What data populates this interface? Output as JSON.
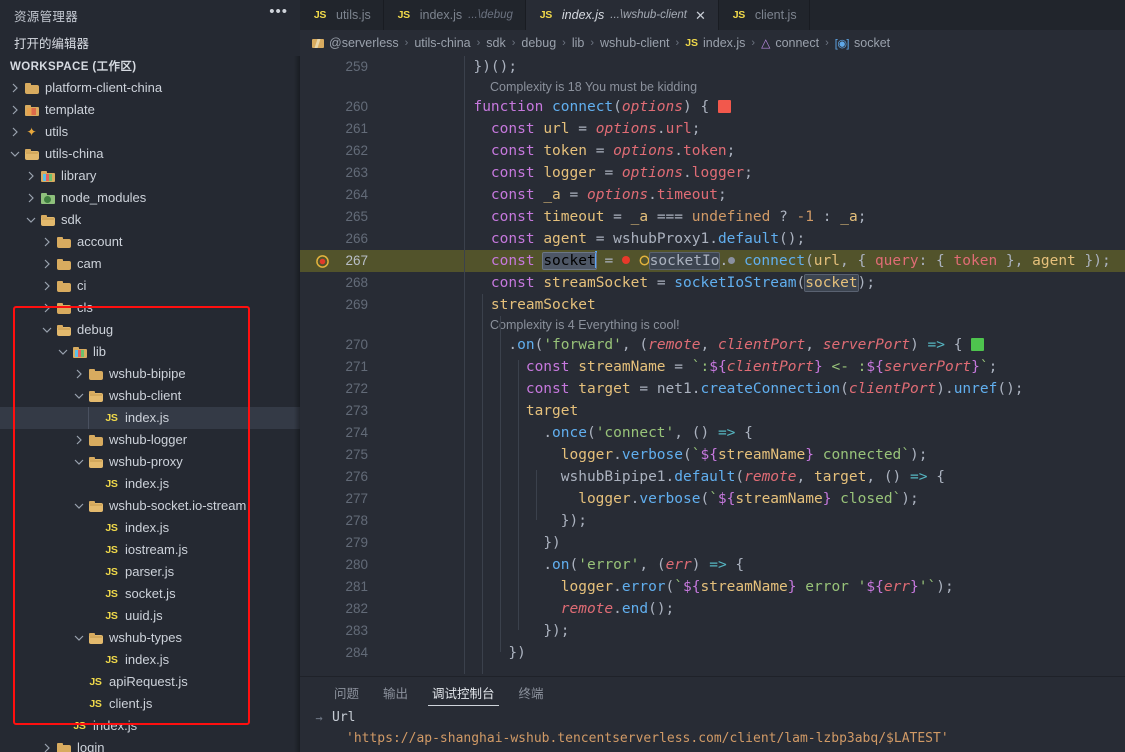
{
  "sidebar": {
    "title": "资源管理器",
    "menu_icon": "ellipsis-icon",
    "open_editors_label": "打开的编辑器",
    "workspace_label": "WORKSPACE (工作区)",
    "tree": [
      {
        "label": "platform-client-china",
        "type": "folder",
        "icon": "folder-icon",
        "depth": 1,
        "state": "collapsed"
      },
      {
        "label": "template",
        "type": "folder",
        "icon": "template-folder-icon",
        "depth": 1,
        "state": "collapsed"
      },
      {
        "label": "utils",
        "type": "folder",
        "icon": "utils-folder-icon",
        "depth": 1,
        "state": "collapsed"
      },
      {
        "label": "utils-china",
        "type": "folder",
        "icon": "folder-open-icon",
        "depth": 1,
        "state": "expanded"
      },
      {
        "label": "library",
        "type": "folder",
        "icon": "library-folder-icon",
        "depth": 2,
        "state": "collapsed"
      },
      {
        "label": "node_modules",
        "type": "folder",
        "icon": "node-modules-folder-icon",
        "depth": 2,
        "state": "collapsed"
      },
      {
        "label": "sdk",
        "type": "folder",
        "icon": "folder-open-icon",
        "depth": 2,
        "state": "expanded"
      },
      {
        "label": "account",
        "type": "folder",
        "icon": "folder-icon",
        "depth": 3,
        "state": "collapsed"
      },
      {
        "label": "cam",
        "type": "folder",
        "icon": "folder-icon",
        "depth": 3,
        "state": "collapsed"
      },
      {
        "label": "ci",
        "type": "folder",
        "icon": "folder-icon",
        "depth": 3,
        "state": "collapsed"
      },
      {
        "label": "cls",
        "type": "folder",
        "icon": "folder-icon",
        "depth": 3,
        "state": "collapsed"
      },
      {
        "label": "debug",
        "type": "folder",
        "icon": "folder-open-icon",
        "depth": 3,
        "state": "expanded"
      },
      {
        "label": "lib",
        "type": "folder",
        "icon": "library-folder-icon",
        "depth": 4,
        "state": "expanded"
      },
      {
        "label": "wshub-bipipe",
        "type": "folder",
        "icon": "folder-icon",
        "depth": 5,
        "state": "collapsed"
      },
      {
        "label": "wshub-client",
        "type": "folder",
        "icon": "folder-open-icon",
        "depth": 5,
        "state": "expanded"
      },
      {
        "label": "index.js",
        "type": "file",
        "icon": "js-file-icon",
        "depth": 6,
        "state": "selected"
      },
      {
        "label": "wshub-logger",
        "type": "folder",
        "icon": "folder-icon",
        "depth": 5,
        "state": "collapsed"
      },
      {
        "label": "wshub-proxy",
        "type": "folder",
        "icon": "folder-open-icon",
        "depth": 5,
        "state": "expanded"
      },
      {
        "label": "index.js",
        "type": "file",
        "icon": "js-file-icon",
        "depth": 6,
        "state": "normal"
      },
      {
        "label": "wshub-socket.io-stream",
        "type": "folder",
        "icon": "folder-open-icon",
        "depth": 5,
        "state": "expanded"
      },
      {
        "label": "index.js",
        "type": "file",
        "icon": "js-file-icon",
        "depth": 6,
        "state": "normal"
      },
      {
        "label": "iostream.js",
        "type": "file",
        "icon": "js-file-icon",
        "depth": 6,
        "state": "normal"
      },
      {
        "label": "parser.js",
        "type": "file",
        "icon": "js-file-icon",
        "depth": 6,
        "state": "normal"
      },
      {
        "label": "socket.js",
        "type": "file",
        "icon": "js-file-icon",
        "depth": 6,
        "state": "normal"
      },
      {
        "label": "uuid.js",
        "type": "file",
        "icon": "js-file-icon",
        "depth": 6,
        "state": "normal"
      },
      {
        "label": "wshub-types",
        "type": "folder",
        "icon": "folder-open-icon",
        "depth": 5,
        "state": "expanded"
      },
      {
        "label": "index.js",
        "type": "file",
        "icon": "js-file-icon",
        "depth": 6,
        "state": "normal"
      },
      {
        "label": "apiRequest.js",
        "type": "file",
        "icon": "js-file-icon",
        "depth": 5,
        "state": "normal"
      },
      {
        "label": "client.js",
        "type": "file",
        "icon": "js-file-icon",
        "depth": 5,
        "state": "normal"
      },
      {
        "label": "index.js",
        "type": "file",
        "icon": "js-file-icon",
        "depth": 4,
        "state": "normal"
      },
      {
        "label": "login",
        "type": "folder",
        "icon": "folder-icon",
        "depth": 3,
        "state": "collapsed"
      }
    ],
    "annotation_color": "#ff0f0f"
  },
  "tabs": [
    {
      "name": "utils.js",
      "sub": "",
      "active": false,
      "icon": "js-file-icon",
      "closable": false
    },
    {
      "name": "index.js",
      "sub": "...\\debug",
      "active": false,
      "icon": "js-file-icon",
      "closable": false
    },
    {
      "name": "index.js",
      "sub": "...\\wshub-client",
      "active": true,
      "icon": "js-file-icon",
      "closable": true,
      "close_glyph": "✕"
    },
    {
      "name": "client.js",
      "sub": "",
      "active": false,
      "icon": "js-file-icon",
      "closable": false
    }
  ],
  "breadcrumb": [
    {
      "label": "@serverless",
      "icon": "serverless-folder-icon"
    },
    {
      "label": "utils-china",
      "icon": ""
    },
    {
      "label": "sdk",
      "icon": ""
    },
    {
      "label": "debug",
      "icon": ""
    },
    {
      "label": "lib",
      "icon": ""
    },
    {
      "label": "wshub-client",
      "icon": ""
    },
    {
      "label": "index.js",
      "icon": "js-file-icon"
    },
    {
      "label": "connect",
      "icon": "function-symbol-icon"
    },
    {
      "label": "socket",
      "icon": "variable-symbol-icon"
    }
  ],
  "breadcrumb_separator": "›",
  "code": {
    "first_line": 259,
    "last_line": 284,
    "active_line": 267,
    "breakpoint_line": 267,
    "lines": [
      {
        "n": 259,
        "text": "  })();"
      },
      {
        "n": 260,
        "text": "  function connect(options) {",
        "badge": "red"
      },
      {
        "n": 261,
        "text": "    const url = options.url;"
      },
      {
        "n": 262,
        "text": "    const token = options.token;"
      },
      {
        "n": 263,
        "text": "    const logger = options.logger;"
      },
      {
        "n": 264,
        "text": "    const _a = options.timeout;"
      },
      {
        "n": 265,
        "text": "    const timeout = _a === undefined ? -1 : _a;"
      },
      {
        "n": 266,
        "text": "    const agent = wshubProxy1.default();"
      },
      {
        "n": 267,
        "text": "    const socket = socketIo.connect(url, { query: { token }, agent });"
      },
      {
        "n": 268,
        "text": "    const streamSocket = socketIoStream(socket);"
      },
      {
        "n": 269,
        "text": "    streamSocket"
      },
      {
        "n": 270,
        "text": "      .on('forward', (remote, clientPort, serverPort) => {",
        "badge": "green"
      },
      {
        "n": 271,
        "text": "        const streamName = `:${clientPort} <- :${serverPort}`;"
      },
      {
        "n": 272,
        "text": "        const target = net1.createConnection(clientPort).unref();"
      },
      {
        "n": 273,
        "text": "        target"
      },
      {
        "n": 274,
        "text": "          .once('connect', () => {"
      },
      {
        "n": 275,
        "text": "            logger.verbose(`${streamName} connected`);"
      },
      {
        "n": 276,
        "text": "            wshubBipipe1.default(remote, target, () => {"
      },
      {
        "n": 277,
        "text": "              logger.verbose(`${streamName} closed`);"
      },
      {
        "n": 278,
        "text": "            });"
      },
      {
        "n": 279,
        "text": "          })"
      },
      {
        "n": 280,
        "text": "          .on('error', (err) => {"
      },
      {
        "n": 281,
        "text": "            logger.error(`${streamName} error '${err}'`);"
      },
      {
        "n": 282,
        "text": "            remote.end();"
      },
      {
        "n": 283,
        "text": "          });"
      },
      {
        "n": 284,
        "text": "      })"
      }
    ],
    "codelens": [
      {
        "after_line": 259,
        "text": "Complexity is 18 You must be kidding"
      },
      {
        "after_line": 269,
        "text": "Complexity is 4 Everything is cool!"
      }
    ],
    "selected_token": "socket",
    "occurrence_token": "socket"
  },
  "panel": {
    "tabs": [
      {
        "label": "问题",
        "active": false
      },
      {
        "label": "输出",
        "active": false
      },
      {
        "label": "调试控制台",
        "active": true
      },
      {
        "label": "终端",
        "active": false
      }
    ],
    "arrow_glyph": "→",
    "url_label": "Url",
    "url_value": "'https://ap-shanghai-wshub.tencentserverless.com/client/lam-lzbp3abq/$LATEST'"
  },
  "colors": {
    "sidebar_bg": "#252932",
    "editor_bg": "#282c35",
    "tabbar_bg": "#21252c",
    "active_line": "#5c5c2a",
    "annotation": "#ff0f0f",
    "js_yellow": "#f0d94a",
    "folder": "#d8ab5f"
  }
}
